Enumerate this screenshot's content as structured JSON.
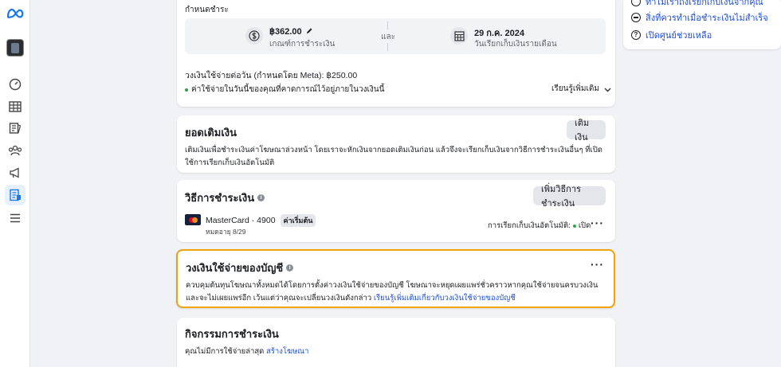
{
  "payment_terms": {
    "heading": "กำหนดชำระ",
    "threshold_amount": "฿362.00",
    "threshold_label": "เกณฑ์การชำระเงิน",
    "and_label": "และ",
    "date": "29 ก.ค. 2024",
    "date_label": "วันเรียกเก็บเงินรายเดือน",
    "daily_limit": "วงเงินใช้จ่ายต่อวัน (กำหนดโดย Meta): ฿250.00",
    "status_note": "ค่าใช้จ่ายในวันนี้ของคุณที่คาดการณ์ไว้อยู่ภายในวงเงินนี้",
    "learn_more": "เรียนรู้เพิ่มเติม"
  },
  "prepaid": {
    "title": "ยอดเติมเงิน",
    "button": "เติมเงิน",
    "description": "เติมเงินเพื่อชำระเงินค่าโฆษณาล่วงหน้า โดยเราจะหักเงินจากยอดเติมเงินก่อน แล้วจึงจะเรียกเก็บเงินจากวิธีการชำระเงินอื่นๆ ที่เปิดใช้การเรียกเก็บเงินอัตโนมัติ"
  },
  "payment_methods": {
    "title": "วิธีการชำระเงิน",
    "add_button": "เพิ่มวิธีการชำระเงิน",
    "card_name": "MasterCard · 4900",
    "default_badge": "ค่าเริ่มต้น",
    "expiry": "หมดอายุ 8/29",
    "autopay_label": "การเรียกเก็บเงินอัตโนมัติ:",
    "autopay_status": "เปิด"
  },
  "spending_limit": {
    "title": "วงเงินใช้จ่ายของบัญชี",
    "description": "ควบคุมต้นทุนโฆษณาทั้งหมดได้โดยการตั้งค่าวงเงินใช้จ่ายของบัญชี โฆษณาจะหยุดเผยแพร่ชั่วคราวหากคุณใช้จ่ายจนครบวงเงินและจะไม่เผยแพร่อีก เว้นแต่ว่าคุณจะเปลี่ยนวงเงินดังกล่าว",
    "link": "เรียนรู้เพิ่มเติมเกี่ยวกับวงเงินใช้จ่ายของบัญชี",
    "highlight_color": "#f0a30a"
  },
  "activity": {
    "title": "กิจกรรมการชำระเงิน",
    "empty_text": "คุณไม่มีการใช้จ่ายล่าสุด",
    "create_link": "สร้างโฆษณา"
  },
  "help": {
    "link_top": "ทำไมเราถึงเรียกเก็บเงินจากคุณ",
    "link_failed": "สิ่งที่ควรทำเมื่อชำระเงินไม่สำเร็จ",
    "link_help": "เปิดศูนย์ช่วยเหลือ"
  },
  "colors": {
    "accent": "#1877f2",
    "link": "#1d4ed8",
    "status_green": "#31a24c"
  }
}
